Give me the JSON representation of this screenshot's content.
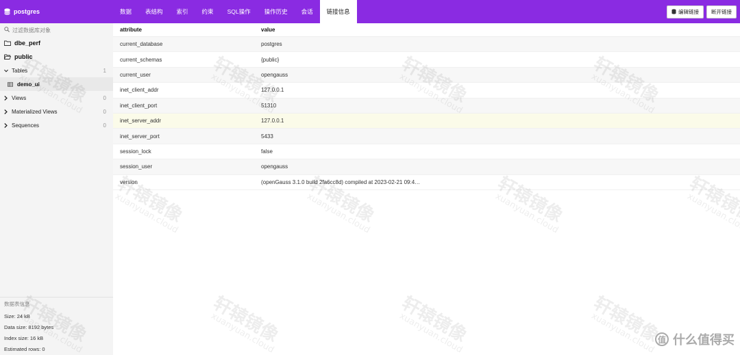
{
  "sidebar": {
    "db_name": "postgres",
    "filter_placeholder": "过滤数据库对象",
    "schemas": [
      "dbe_perf",
      "public"
    ],
    "groups": {
      "tables": {
        "label": "Tables",
        "count": "1"
      },
      "views": {
        "label": "Views",
        "count": "0"
      },
      "materialized_views": {
        "label": "Materialized Views",
        "count": "0"
      },
      "sequences": {
        "label": "Sequences",
        "count": "0"
      }
    },
    "table_items": [
      "demo_ui"
    ],
    "info": {
      "title": "数据表信息",
      "size": "Size: 24 kB",
      "data_size": "Data size: 8192 bytes",
      "index_size": "Index size: 16 kB",
      "estimated_rows": "Estimated rows: 0"
    }
  },
  "tabs": [
    "数据",
    "表结构",
    "索引",
    "约束",
    "SQL操作",
    "操作历史",
    "会话",
    "链接信息"
  ],
  "active_tab": "链接信息",
  "actions": {
    "edit_label": "编辑链接",
    "disconnect_label": "断开链接"
  },
  "table": {
    "columns": [
      "attribute",
      "value"
    ],
    "rows": [
      [
        "current_database",
        "postgres"
      ],
      [
        "current_schemas",
        "{public}"
      ],
      [
        "current_user",
        "opengauss"
      ],
      [
        "inet_client_addr",
        "127.0.0.1"
      ],
      [
        "inet_client_port",
        "51310"
      ],
      [
        "inet_server_addr",
        "127.0.0.1"
      ],
      [
        "inet_server_port",
        "5433"
      ],
      [
        "session_lock",
        "false"
      ],
      [
        "session_user",
        "opengauss"
      ],
      [
        "version",
        "(openGauss 3.1.0 build 2fa6cc8d) compiled at 2023-02-21 09:4…"
      ]
    ],
    "highlighted_row": "inet_server_addr"
  },
  "watermark": {
    "brand": "轩辕镜像",
    "domain": "xuanyuan.cloud"
  },
  "corner_logo": {
    "glyph": "值",
    "text": "什么值得买"
  },
  "colors": {
    "accent": "#8a2be2",
    "sidebar_bg": "#f4f4f4",
    "row_highlight": "#fbfbe9"
  }
}
